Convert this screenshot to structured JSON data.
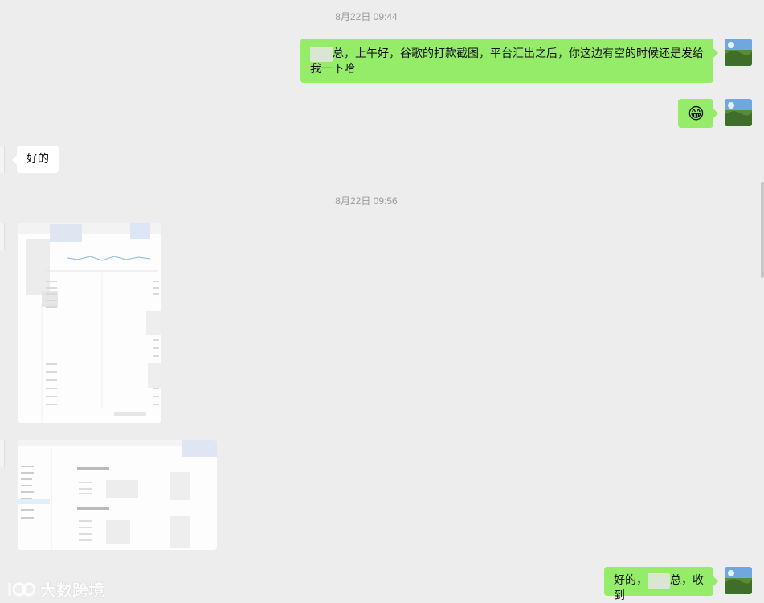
{
  "messages": {
    "ts1": "8月22日 09:44",
    "m1_after_blur": "总，上午好，谷歌的打款截图，平台汇出之后，你这边有空的时候还是发给我一下哈",
    "m2_emoji": "😁",
    "m3": "好的",
    "ts2": "8月22日 09:56",
    "m6_before": "好的，",
    "m6_after": "总，收到"
  },
  "watermark": {
    "text": "大数跨境"
  },
  "colors": {
    "background": "#ededed",
    "sent_bubble": "#95ec69",
    "received_bubble": "#ffffff",
    "timestamp": "#9a9a9a"
  }
}
